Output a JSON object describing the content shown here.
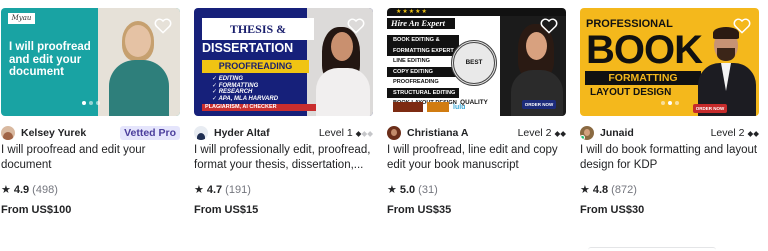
{
  "gigs": [
    {
      "thumb": {
        "logo": "Myau",
        "headline": "I will proofread and edit your document"
      },
      "seller_name": "Kelsey Yurek",
      "badge": "Vetted Pro",
      "title_lines": [
        "I will proofread and edit your",
        "document"
      ],
      "rating": "4.9",
      "reviews": "(498)",
      "price": "From US$100"
    },
    {
      "thumb": {
        "title_top": "THESIS &",
        "title_main": "DISSERTATION",
        "banner": "PROOFREADING",
        "bullets": [
          "✓ EDITING",
          "✓ FORMATTING",
          "✓ RESEARCH",
          "✓ APA, MLA HARVARD"
        ],
        "footer": "PLAGIARISM, AI CHECKER"
      },
      "seller_name": "Hyder Altaf",
      "level": "Level 1",
      "level_diamonds_on": 1,
      "title_lines": [
        "I will professionally edit, proofread,",
        "format your thesis, dissertation,..."
      ],
      "rating": "4.7",
      "reviews": "(191)",
      "price": "From US$15"
    },
    {
      "thumb": {
        "stars": "★★★★★",
        "headline": "Hire An Expert",
        "list": [
          "BOOK EDITING &",
          "FORMATTING EXPERT",
          "LINE EDITING",
          "COPY EDITING",
          "PROOFREADING",
          "STRUCTURAL EDITING",
          "BOOK LAYOUT DESIGN"
        ],
        "seal": "BEST QUALITY",
        "brand": "lulu",
        "cta": "ORDER NOW"
      },
      "seller_name": "Christiana A",
      "level": "Level 2",
      "level_diamonds_on": 2,
      "title_lines": [
        "I will proofread, line edit and copy",
        "edit your book manuscript"
      ],
      "rating": "5.0",
      "reviews": "(31)",
      "price": "From US$35"
    },
    {
      "thumb": {
        "top": "PROFESSIONAL",
        "big": "BOOK",
        "banner": "FORMATTING",
        "sub": "LAYOUT DESIGN",
        "cta": "ORDER NOW"
      },
      "seller_name": "Junaid",
      "level": "Level 2",
      "level_diamonds_on": 2,
      "title_lines": [
        "I will do book formatting and layout",
        "design for KDP"
      ],
      "rating": "4.8",
      "reviews": "(872)",
      "price": "From US$30"
    }
  ]
}
